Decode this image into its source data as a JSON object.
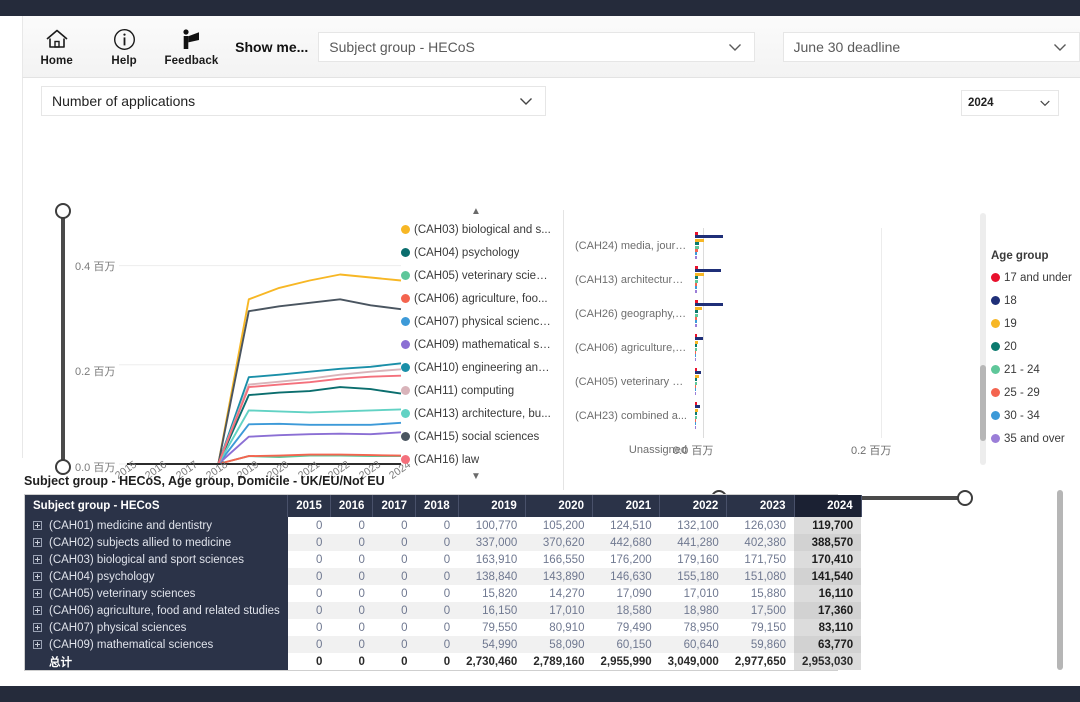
{
  "ribbon": {
    "buttons": [
      {
        "label": "Home",
        "icon": "home-icon"
      },
      {
        "label": "Help",
        "icon": "info-icon"
      },
      {
        "label": "Feedback",
        "icon": "feedback-icon"
      }
    ],
    "show_me_label": "Show me...",
    "subject_combo": {
      "value": "Subject group - HECoS",
      "icon": "chevron-down-icon"
    },
    "deadline_combo": {
      "value": "June 30 deadline",
      "icon": "chevron-down-icon"
    }
  },
  "panel": {
    "measure_combo": {
      "value": "Number of applications",
      "icon": "chevron-down-icon"
    },
    "year_combo": {
      "value": "2024",
      "icon": "chevron-down-icon"
    }
  },
  "age_legend": {
    "title": "Age group",
    "items": [
      {
        "label": "17 and under",
        "color": "#e8112d"
      },
      {
        "label": "18",
        "color": "#1f2f78"
      },
      {
        "label": "19",
        "color": "#f7b725"
      },
      {
        "label": "20",
        "color": "#0b7a6e"
      },
      {
        "label": "21 - 24",
        "color": "#5fc79a"
      },
      {
        "label": "25 - 29",
        "color": "#f4644f"
      },
      {
        "label": "30 - 34",
        "color": "#3d9ad8"
      },
      {
        "label": "35 and over",
        "color": "#9b7ed8"
      }
    ]
  },
  "chart_data": [
    {
      "type": "line",
      "title": "",
      "xlabel": "",
      "ylabel": "",
      "x": [
        "2015",
        "2016",
        "2017",
        "2018",
        "2019",
        "2020",
        "2021",
        "2022",
        "2023",
        "2024"
      ],
      "ytick_labels": [
        "0.0 百万",
        "0.2 百万",
        "0.4 百万"
      ],
      "ytick_values": [
        0,
        200000,
        400000
      ],
      "ylim": [
        0,
        500000
      ],
      "grid": true,
      "legend_position": "right",
      "legend_scroll_up_icon": "triangle-up-icon",
      "legend_scroll_down_icon": "triangle-down-icon",
      "series": [
        {
          "name": "(CAH03) biological and s...",
          "color": "#f7b725",
          "values": [
            0,
            0,
            0,
            0,
            332000,
            355000,
            370000,
            382000,
            376000,
            370000
          ]
        },
        {
          "name": "(CAH04) psychology",
          "color": "#0b6e6e",
          "values": [
            0,
            0,
            0,
            0,
            139000,
            144000,
            147000,
            155000,
            151000,
            142000
          ]
        },
        {
          "name": "(CAH05) veterinary scien...",
          "color": "#5fc79a",
          "values": [
            0,
            0,
            0,
            0,
            16000,
            14000,
            17000,
            17000,
            16000,
            16000
          ]
        },
        {
          "name": "(CAH06) agriculture, foo...",
          "color": "#f4644f",
          "values": [
            0,
            0,
            0,
            0,
            16000,
            17000,
            19000,
            19000,
            18000,
            17000
          ]
        },
        {
          "name": "(CAH07) physical sciences",
          "color": "#3d9ad8",
          "values": [
            0,
            0,
            0,
            0,
            80000,
            81000,
            79000,
            79000,
            79000,
            83000
          ]
        },
        {
          "name": "(CAH09) mathematical sc...",
          "color": "#8b6fd4",
          "values": [
            0,
            0,
            0,
            0,
            55000,
            58000,
            60000,
            61000,
            60000,
            64000
          ]
        },
        {
          "name": "(CAH10) engineering and...",
          "color": "#1a8fa8",
          "values": [
            0,
            0,
            0,
            0,
            175000,
            180000,
            186000,
            192000,
            196000,
            203000
          ]
        },
        {
          "name": "(CAH11) computing",
          "color": "#d9b4ba",
          "values": [
            0,
            0,
            0,
            0,
            160000,
            166000,
            172000,
            180000,
            186000,
            191000
          ]
        },
        {
          "name": "(CAH13) architecture, bu...",
          "color": "#62d2c4",
          "values": [
            0,
            0,
            0,
            0,
            108000,
            106000,
            104000,
            106000,
            108000,
            110000
          ]
        },
        {
          "name": "(CAH15) social sciences",
          "color": "#4a5560",
          "values": [
            0,
            0,
            0,
            0,
            308000,
            318000,
            325000,
            332000,
            320000,
            312000
          ]
        },
        {
          "name": "(CAH16) law",
          "color": "#f4707c",
          "values": [
            0,
            0,
            0,
            0,
            155000,
            160000,
            165000,
            172000,
            176000,
            178000
          ]
        }
      ]
    },
    {
      "type": "bar",
      "orientation": "horizontal",
      "title": "",
      "xtick_labels": [
        "0.0 百万",
        "0.2 百万"
      ],
      "xtick_values": [
        0,
        200000
      ],
      "xlim": [
        0,
        280000
      ],
      "categories": [
        "(CAH24) media, journ...",
        "(CAH13) architecture,...",
        "(CAH26) geography, e...",
        "(CAH06) agriculture, f...",
        "(CAH05) veterinary sc...",
        "(CAH23) combined a...",
        "Unassigned"
      ],
      "series": [
        {
          "name": "17 and under",
          "color": "#e8112d",
          "values": [
            5000,
            5200,
            5200,
            2600,
            3000,
            2400,
            0
          ]
        },
        {
          "name": "18",
          "color": "#1f2f78",
          "values": [
            44000,
            41000,
            44000,
            12000,
            10000,
            8000,
            0
          ]
        },
        {
          "name": "19",
          "color": "#f7b725",
          "values": [
            14000,
            14000,
            11000,
            5000,
            6000,
            4000,
            0
          ]
        },
        {
          "name": "20",
          "color": "#0b7a6e",
          "values": [
            6000,
            5000,
            5000,
            3000,
            2600,
            2600,
            0
          ]
        },
        {
          "name": "21 - 24",
          "color": "#5fc79a",
          "values": [
            6000,
            5000,
            5000,
            3000,
            2600,
            2600,
            0
          ]
        },
        {
          "name": "25 - 29",
          "color": "#f4644f",
          "values": [
            4000,
            3000,
            3000,
            2000,
            2000,
            1600,
            0
          ]
        },
        {
          "name": "30 - 34",
          "color": "#3d9ad8",
          "values": [
            3000,
            2600,
            2600,
            1600,
            1600,
            1400,
            0
          ]
        },
        {
          "name": "35 and over",
          "color": "#9b7ed8",
          "values": [
            3000,
            2600,
            2600,
            1600,
            1600,
            1400,
            0
          ]
        }
      ]
    }
  ],
  "table": {
    "caption": "Subject group - HECoS, Age group, Domicile - UK/EU/Not EU",
    "first_column_header": "Subject group - HECoS",
    "year_headers": [
      "2015",
      "2016",
      "2017",
      "2018",
      "2019",
      "2020",
      "2021",
      "2022",
      "2023",
      "2024"
    ],
    "selected_year": "2024",
    "rows": [
      {
        "label": "(CAH01) medicine and dentistry",
        "values": [
          "0",
          "0",
          "0",
          "0",
          "100,770",
          "105,200",
          "124,510",
          "132,100",
          "126,030",
          "119,700"
        ]
      },
      {
        "label": "(CAH02) subjects allied to medicine",
        "values": [
          "0",
          "0",
          "0",
          "0",
          "337,000",
          "370,620",
          "442,680",
          "441,280",
          "402,380",
          "388,570"
        ]
      },
      {
        "label": "(CAH03) biological and sport sciences",
        "values": [
          "0",
          "0",
          "0",
          "0",
          "163,910",
          "166,550",
          "176,200",
          "179,160",
          "171,750",
          "170,410"
        ]
      },
      {
        "label": "(CAH04) psychology",
        "values": [
          "0",
          "0",
          "0",
          "0",
          "138,840",
          "143,890",
          "146,630",
          "155,180",
          "151,080",
          "141,540"
        ]
      },
      {
        "label": "(CAH05) veterinary sciences",
        "values": [
          "0",
          "0",
          "0",
          "0",
          "15,820",
          "14,270",
          "17,090",
          "17,010",
          "15,880",
          "16,110"
        ]
      },
      {
        "label": "(CAH06) agriculture, food and related studies",
        "values": [
          "0",
          "0",
          "0",
          "0",
          "16,150",
          "17,010",
          "18,580",
          "18,980",
          "17,500",
          "17,360"
        ]
      },
      {
        "label": "(CAH07) physical sciences",
        "values": [
          "0",
          "0",
          "0",
          "0",
          "79,550",
          "80,910",
          "79,490",
          "78,950",
          "79,150",
          "83,110"
        ]
      },
      {
        "label": "(CAH09) mathematical sciences",
        "values": [
          "0",
          "0",
          "0",
          "0",
          "54,990",
          "58,090",
          "60,150",
          "60,640",
          "59,860",
          "63,770"
        ]
      }
    ],
    "total_row": {
      "label": "总计",
      "values": [
        "0",
        "0",
        "0",
        "0",
        "2,730,460",
        "2,789,160",
        "2,955,990",
        "3,049,000",
        "2,977,650",
        "2,953,030"
      ]
    }
  }
}
